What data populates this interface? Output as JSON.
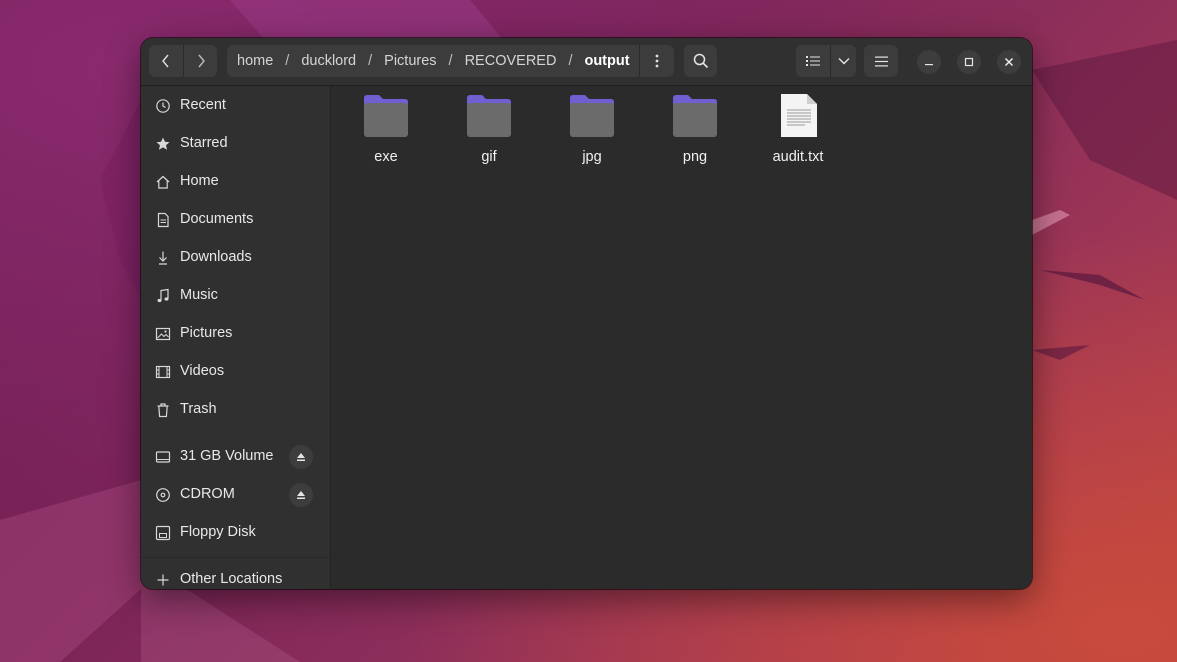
{
  "path": {
    "segments": [
      "home",
      "ducklord",
      "Pictures",
      "RECOVERED"
    ],
    "current": "output"
  },
  "sidebar": {
    "places": [
      {
        "label": "Recent",
        "icon": "clock-icon"
      },
      {
        "label": "Starred",
        "icon": "star-icon"
      },
      {
        "label": "Home",
        "icon": "home-icon"
      },
      {
        "label": "Documents",
        "icon": "document-icon"
      },
      {
        "label": "Downloads",
        "icon": "download-icon"
      },
      {
        "label": "Music",
        "icon": "music-icon"
      },
      {
        "label": "Pictures",
        "icon": "picture-icon"
      },
      {
        "label": "Videos",
        "icon": "video-icon"
      },
      {
        "label": "Trash",
        "icon": "trash-icon"
      }
    ],
    "devices": [
      {
        "label": "31 GB Volume",
        "icon": "drive-icon",
        "ejectable": true
      },
      {
        "label": "CDROM",
        "icon": "disc-icon",
        "ejectable": true
      },
      {
        "label": "Floppy Disk",
        "icon": "floppy-icon",
        "ejectable": false
      }
    ],
    "other": {
      "label": "Other Locations",
      "icon": "plus-icon"
    }
  },
  "files": [
    {
      "name": "exe",
      "type": "folder"
    },
    {
      "name": "gif",
      "type": "folder"
    },
    {
      "name": "jpg",
      "type": "folder"
    },
    {
      "name": "png",
      "type": "folder"
    },
    {
      "name": "audit.txt",
      "type": "text"
    }
  ],
  "colors": {
    "window_bg": "#2b2b2b",
    "sidebar_bg": "#303030",
    "folder_body": "#6a6a6a",
    "folder_tab": "#6a5acd",
    "text": "#e8e8e8"
  }
}
